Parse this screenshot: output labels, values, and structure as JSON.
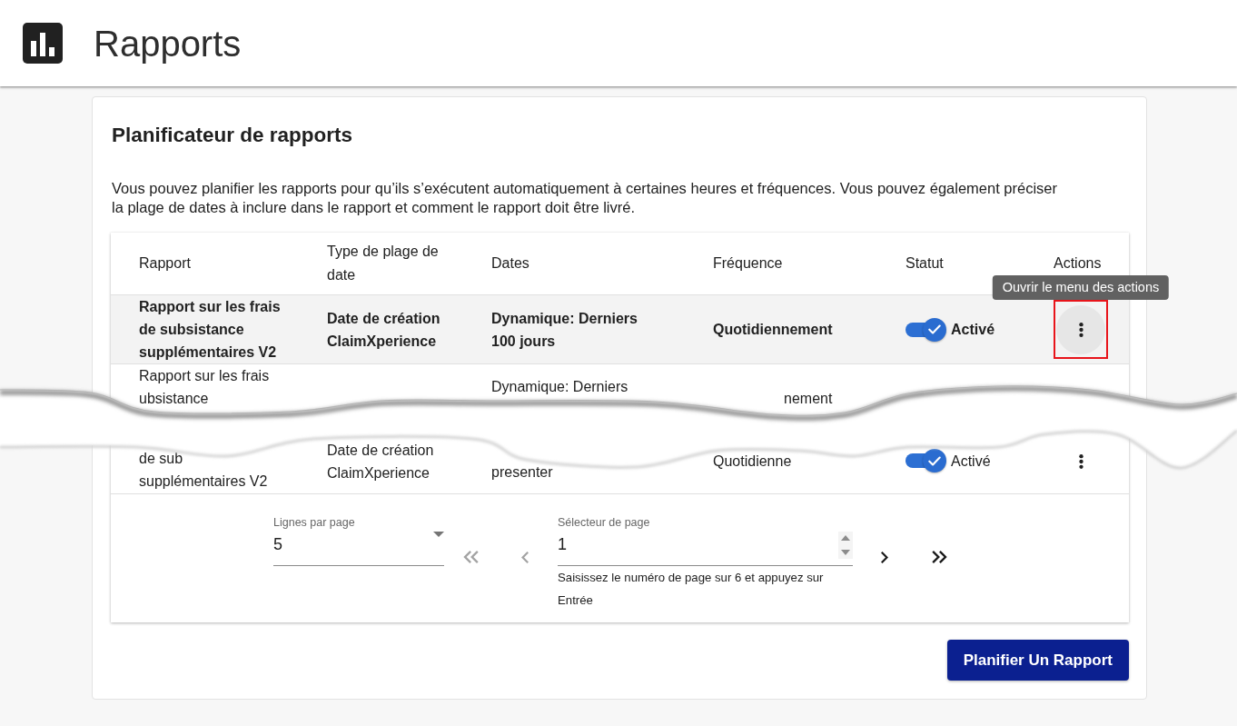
{
  "header": {
    "title": "Rapports"
  },
  "scheduler": {
    "title": "Planificateur de rapports",
    "description": "Vous pouvez planifier les rapports pour qu’ils s’exécutent automatiquement à certaines heures et fréquences. Vous pouvez également préciser la plage de dates à inclure dans le rapport et comment le rapport doit être livré.",
    "table": {
      "columns": [
        "Rapport",
        "Type de plage de date",
        "Dates",
        "Fréquence",
        "Statut",
        "Actions"
      ],
      "rows": [
        {
          "kind": "full",
          "selected": true,
          "report": [
            "Rapport sur les frais de subsistance supplémentaires V2"
          ],
          "date_type": [
            "Date de création ClaimXperience"
          ],
          "dates": [
            "Dynamique: Derniers 100 jours"
          ],
          "frequency": "Quotidiennement",
          "status": {
            "on": true,
            "label": "Activé"
          },
          "actions": {
            "hovered": true,
            "framed": true,
            "tooltip": "Ouvrir le menu des actions"
          }
        },
        {
          "kind": "cut_top",
          "selected": false,
          "report": [
            "Rapport sur les frais",
            "ubsistance"
          ],
          "dates": [
            "Dynamique: Derniers"
          ],
          "frequency": "nement"
        },
        {
          "kind": "cut_bottom",
          "selected": false,
          "report": [
            "de sub",
            "supplémentaires V2"
          ],
          "date_type": [
            "Date de création ClaimXperience"
          ],
          "dates": [
            "presenter"
          ],
          "frequency": "Quotidienne",
          "status": {
            "on": true,
            "label": "Activé"
          },
          "actions": {
            "hovered": false,
            "framed": false
          }
        }
      ]
    },
    "pagination": {
      "rows_per_page": {
        "label": "Lignes par page",
        "value": "5"
      },
      "nav_before": [
        {
          "kind": "first",
          "disabled": true
        },
        {
          "kind": "previous",
          "disabled": true
        }
      ],
      "page_selector": {
        "label": "Sélecteur de page",
        "value": "1",
        "helper": "Saisissez le numéro de page sur 6 et appuyez sur Entrée"
      },
      "nav_after": [
        {
          "kind": "next",
          "disabled": false
        },
        {
          "kind": "last",
          "disabled": false
        }
      ]
    },
    "primary_button": "Planifier Un Rapport"
  }
}
